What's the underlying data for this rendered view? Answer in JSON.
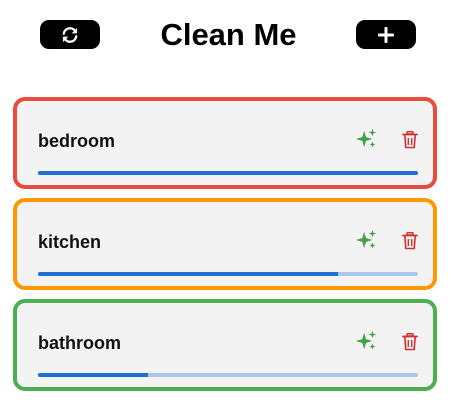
{
  "header": {
    "title": "Clean Me",
    "refresh_icon": "refresh-icon",
    "add_icon": "plus-icon"
  },
  "colors": {
    "progress_fill": "#1f6fcf",
    "progress_track": "#aac7ea",
    "sparkle": "#43a047",
    "trash": "#d32f2f"
  },
  "rooms": [
    {
      "name": "bedroom",
      "border_color": "#e74c3c",
      "progress": 1.0
    },
    {
      "name": "kitchen",
      "border_color": "#ff9800",
      "progress": 0.79
    },
    {
      "name": "bathroom",
      "border_color": "#4caf50",
      "progress": 0.29
    }
  ]
}
